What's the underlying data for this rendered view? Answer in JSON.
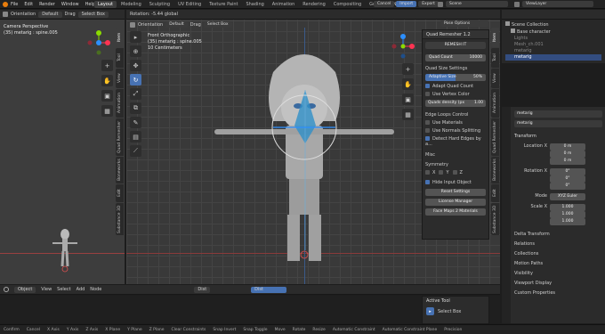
{
  "topbar": {
    "menus": [
      "File",
      "Edit",
      "Render",
      "Window",
      "Help"
    ],
    "workspaces": [
      "Layout",
      "Modeling",
      "Sculpting",
      "UV Editing",
      "Texture Paint",
      "Shading",
      "Animation",
      "Rendering",
      "Compositing",
      "Geometry Nodes"
    ],
    "active_workspace": "Layout",
    "cancel": "Cancel",
    "import": "Import",
    "export": "Export",
    "scene": "Scene",
    "viewlayer": "ViewLayer"
  },
  "left_view": {
    "orientation_label": "Orientation",
    "orientation_value": "Default",
    "drag_label": "Drag",
    "drag_value": "Select Box",
    "title": "Camera Perspective",
    "subtitle": "(35) metarig : spine.005"
  },
  "main_view": {
    "rotation_text": "Rotation: -5.44 global",
    "orientation_label": "Orientation",
    "orientation_value": "Default",
    "drag_label": "Drag",
    "drag_value": "Select Box",
    "title": "Front Orthographic",
    "subtitle": "(35) metarig : spine.005",
    "scale_text": "10 Centimeters",
    "snap_value": "Dist",
    "proportional": "Dist"
  },
  "left_tabs": [
    "Item",
    "Tool",
    "View",
    "Animation",
    "Quad Remesher",
    "Boneworks",
    "Edit",
    "Substance 3D"
  ],
  "right_tabs": [
    "Item",
    "Tool",
    "View",
    "Animation",
    "Quad Remesher",
    "Boneworks",
    "Edit",
    "Substance 3D"
  ],
  "quad_panel": {
    "header": "Quad Remesher 1.2",
    "remesh_button": "REMESH IT",
    "quad_count_label": "Quad Count",
    "quad_count_value": "10000",
    "size_settings": "Quad Size Settings",
    "adaptive_label": "Adaptive Size",
    "adaptive_value": "50%",
    "adapt_quad_count": "Adapt Quad Count",
    "use_vertex_color": "Use Vertex Color",
    "density_label": "Quads density (px",
    "density_value": "1.00",
    "edge_loops": "Edge Loops Control",
    "use_materials": "Use Materials",
    "use_normals": "Use Normals Splitting",
    "detect_hard": "Detect Hard Edges by a...",
    "misc": "Misc",
    "symmetry": "Symmetry",
    "sym_x": "X",
    "sym_y": "Y",
    "sym_z": "Z",
    "hide_input": "Hide Input Object",
    "reset": "Reset Settings",
    "license": "License Manager",
    "face_maps": "Face Maps 2 Materials"
  },
  "options_label": "Pose Options",
  "active_tool": {
    "header": "Active Tool",
    "value": "Select Box"
  },
  "bottom_bar": {
    "mode": "Object",
    "items": [
      "View",
      "Select",
      "Add",
      "Node"
    ]
  },
  "outliner": {
    "title": "Scene Collection",
    "items": [
      "Base character",
      "Lights",
      "Mesh_ch.001",
      "metarig",
      "metarig"
    ]
  },
  "properties": {
    "object_name": "metarig",
    "data_name": "metarig",
    "transform": "Transform",
    "location": {
      "label": "Location X",
      "x": "0 m",
      "y": "0 m",
      "z": "0 m"
    },
    "rotation": {
      "label": "Rotation X",
      "x": "0°",
      "y": "0°",
      "z": "0°"
    },
    "mode_label": "Mode",
    "mode_value": "XYZ Euler",
    "scale": {
      "label": "Scale X",
      "x": "1.000",
      "y": "1.000",
      "z": "1.000"
    },
    "sections": [
      "Delta Transform",
      "Relations",
      "Collections",
      "Motion Paths",
      "Visibility",
      "Viewport Display",
      "Custom Properties"
    ]
  },
  "status": [
    "Confirm",
    "Cancel",
    "X Axis",
    "Y Axis",
    "Z Axis",
    "X Plane",
    "Y Plane",
    "Z Plane",
    "Clear Constraints",
    "Snap Invert",
    "Snap Toggle",
    "Move",
    "Rotate",
    "Resize",
    "Automatic Constraint",
    "Automatic Constraint Plane",
    "Precision"
  ]
}
